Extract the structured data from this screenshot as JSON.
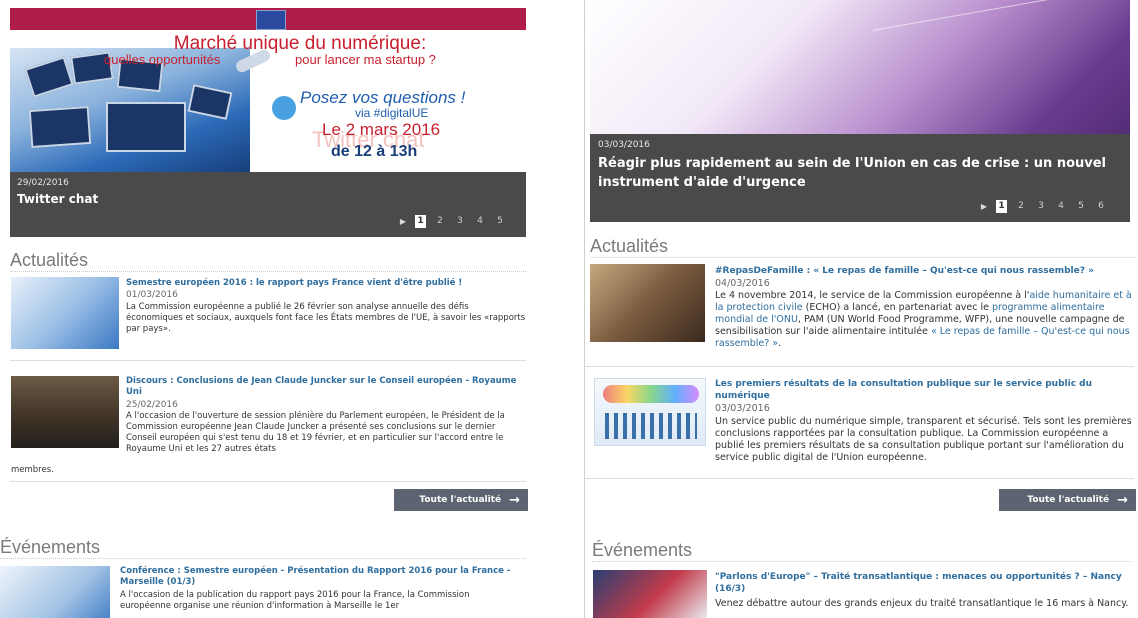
{
  "left": {
    "hero": {
      "headline1": "Marché unique du numérique:",
      "headline2a": "quelles opportunités",
      "headline2b": "pour lancer ma startup ?",
      "posez": "Posez vos questions !",
      "via": "via #digitalUE",
      "date_big": "Le 2 mars 2016",
      "ghost": "Twitter chat",
      "time": "de 12 à 13h",
      "caption_date": "29/02/2016",
      "caption_title": "Twitter chat",
      "pager": {
        "arrow": "▶",
        "pages": [
          "1",
          "2",
          "3",
          "4",
          "5"
        ],
        "active": 0
      }
    },
    "news_heading": "Actualités",
    "news": [
      {
        "title": "Semestre européen 2016 : le rapport pays France vient d'être publié !",
        "date": "01/03/2016",
        "text": "La Commission européenne a publié le 26 février son analyse annuelle des défis économiques et sociaux, auxquels font face les États membres de l'UE, à savoir les «rapports par pays»."
      },
      {
        "title": "Discours : Conclusions de Jean Claude Juncker sur le Conseil européen - Royaume Uni",
        "date": "25/02/2016",
        "text": "A l'occasion de l'ouverture de session plénière du Parlement européen, le Président de la Commission européenne Jean Claude Juncker a présenté ses conclusions sur le dernier Conseil européen qui s'est tenu du 18 et 19 février, et en particulier sur l'accord entre le Royaume Uni et les 27 autres états",
        "text_tail": "membres."
      }
    ],
    "all_news": "Toute l'actualité",
    "events_heading": "Événements",
    "event": {
      "title": "Conférence : Semestre européen - Présentation du Rapport 2016 pour la France - Marseille (01/3)",
      "text": "A l'occasion de la publication du rapport pays 2016 pour la France, la Commission européenne organise une réunion d'information à Marseille le 1er"
    }
  },
  "right": {
    "hero": {
      "caption_date": "03/03/2016",
      "caption_title": "Réagir plus rapidement au sein de l'Union en cas de crise : un nouvel instrument d'aide d'urgence",
      "pager": {
        "arrow": "▶",
        "pages": [
          "1",
          "2",
          "3",
          "4",
          "5",
          "6"
        ],
        "active": 0
      }
    },
    "news_heading": "Actualités",
    "news": [
      {
        "title": "#RepasDeFamille : « Le repas de famille – Qu'est-ce qui nous rassemble? »",
        "date": "04/03/2016",
        "text_a": "Le 4 novembre 2014, le service de la Commission européenne à l'",
        "link_a": "aide humanitaire et à la protection civile",
        "text_b": " (ECHO) a lancé, en partenariat avec le ",
        "link_b": "programme alimentaire mondial de l'ONU",
        "text_c": ", PAM (UN World Food Programme, WFP), une nouvelle campagne de sensibilisation sur l'aide alimentaire intitulée ",
        "link_c": "« Le repas de famille – Qu'est-ce qui nous rassemble? »",
        "text_d": "."
      },
      {
        "title": "Les premiers résultats de la consultation publique sur le service public du numérique",
        "date": "03/03/2016",
        "text": "Un service public du numérique simple, transparent et sécurisé. Tels sont les premières conclusions rapportées par la consultation publique. La Commission européenne a publié les premiers résultats de sa consultation publique portant sur l'amélioration du service public digital de l'Union européenne."
      }
    ],
    "all_news": "Toute l'actualité",
    "events_heading": "Événements",
    "event": {
      "title": "\"Parlons d'Europe\" – Traité transatlantique : menaces ou opportunités ? – Nancy (16/3)",
      "text": "Venez débattre autour des grands enjeux du traité transatlantique le 16 mars à Nancy."
    }
  }
}
